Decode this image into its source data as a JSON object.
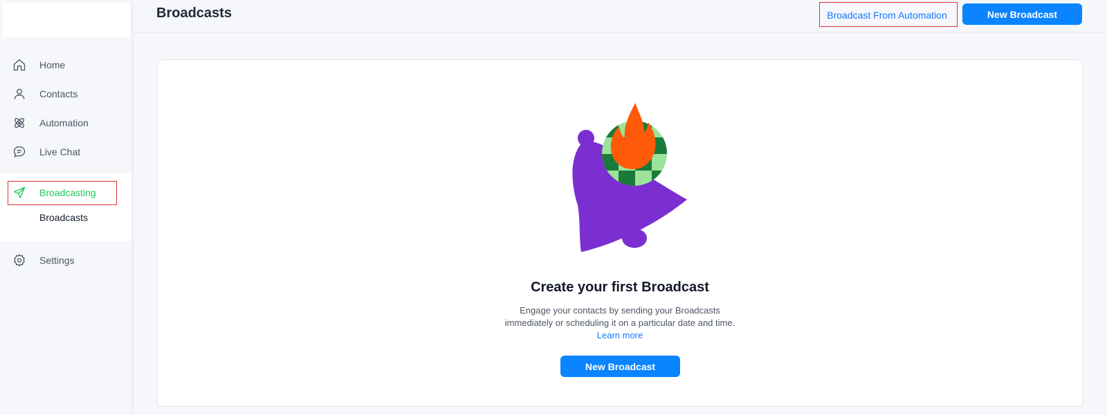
{
  "header": {
    "title": "Broadcasts",
    "broadcast_from_automation_label": "Broadcast From Automation",
    "new_broadcast_label": "New Broadcast"
  },
  "sidebar": {
    "items": [
      {
        "label": "Home",
        "icon": "home-icon"
      },
      {
        "label": "Contacts",
        "icon": "user-icon"
      },
      {
        "label": "Automation",
        "icon": "atom-icon"
      },
      {
        "label": "Live Chat",
        "icon": "chat-icon"
      },
      {
        "label": "Broadcasting",
        "icon": "send-icon"
      },
      {
        "label": "Settings",
        "icon": "gear-icon"
      }
    ],
    "sub_items": [
      {
        "label": "Broadcasts"
      }
    ]
  },
  "empty_state": {
    "title": "Create your first Broadcast",
    "description_line1": "Engage your contacts by sending your Broadcasts",
    "description_line2": "immediately or scheduling it on a particular date and time.",
    "learn_more": "Learn more",
    "button_label": "New Broadcast"
  },
  "colors": {
    "primary": "#0a84ff",
    "active": "#22c55e",
    "highlight": "#e03131",
    "bell": "#7b2fd0",
    "flame": "#ff5a0a",
    "check_dark": "#1a7a3a",
    "check_light": "#9be39b"
  }
}
